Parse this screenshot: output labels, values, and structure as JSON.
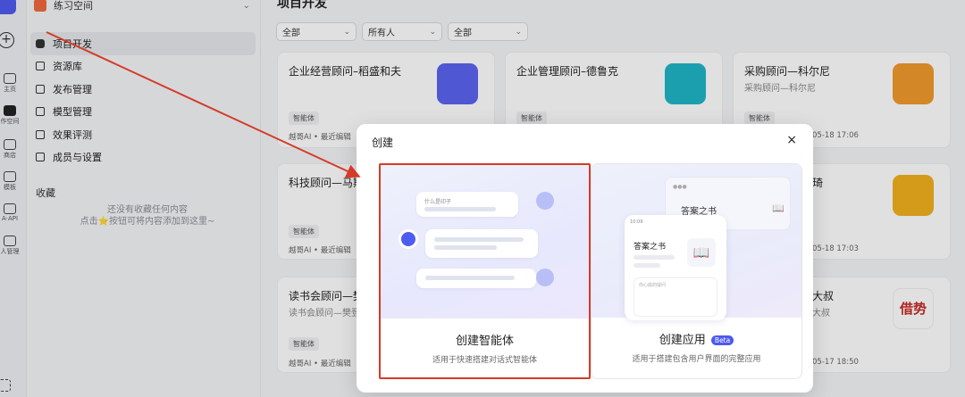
{
  "sidebar": {
    "workspace": "练习空间",
    "rail_labels": [
      "主页",
      "作空间",
      "商店",
      "模板",
      "A·API",
      "人管理"
    ],
    "nav": [
      {
        "label": "项目开发",
        "icon": "project-icon",
        "active": true
      },
      {
        "label": "资源库",
        "icon": "library-icon"
      },
      {
        "label": "发布管理",
        "icon": "rocket-icon"
      },
      {
        "label": "模型管理",
        "icon": "model-icon"
      },
      {
        "label": "效果评测",
        "icon": "evaluate-icon"
      },
      {
        "label": "成员与设置",
        "icon": "members-icon"
      }
    ],
    "favorites_title": "收藏",
    "favorites_empty_line1": "还没有收藏任何内容",
    "favorites_empty_line2": "点击⭐按钮可将内容添加到这里~"
  },
  "main": {
    "title": "项目开发",
    "filters": [
      "全部",
      "所有人",
      "全部"
    ],
    "cards": [
      {
        "title": "企业经营顾问–稻盛和夫",
        "tag": "智能体",
        "meta": "越哥AI • 最近编辑"
      },
      {
        "title": "企业管理顾问–德鲁克",
        "tag": "智能体",
        "meta": ""
      },
      {
        "title": "采购顾问—科尔尼",
        "subtitle": "采购顾问—科尔尼",
        "tag": "智能体",
        "meta": "05-18 17:06"
      },
      {
        "title": "科技顾问—马斯",
        "tag": "智能体",
        "meta": "越哥AI • 最近编辑"
      },
      {
        "title": "琦",
        "meta": "05-18 17:03"
      },
      {
        "title": "读书会顾问—樊",
        "subtitle": "读书会顾问—樊登",
        "tag": "智能体",
        "meta": "越哥AI • 最近编辑"
      },
      {
        "title": "大叔",
        "subtitle": "大叔",
        "meta": "05-17 18:50",
        "icon_text": "借势"
      }
    ]
  },
  "modal": {
    "title": "创建",
    "close": "×",
    "agent": {
      "name": "创建智能体",
      "desc": "适用于快速搭建对话式智能体",
      "preview_bubble_text": "什么是印子"
    },
    "app": {
      "name": "创建应用",
      "badge": "Beta",
      "desc": "适用于搭建包含用户界面的完整应用",
      "preview_title": "答案之书",
      "preview_phone_title": "答案之书",
      "preview_time": "10:09",
      "preview_input": "你心底的疑问"
    }
  },
  "colors": {
    "highlight": "#d43b28",
    "accent": "#4d59f1"
  }
}
